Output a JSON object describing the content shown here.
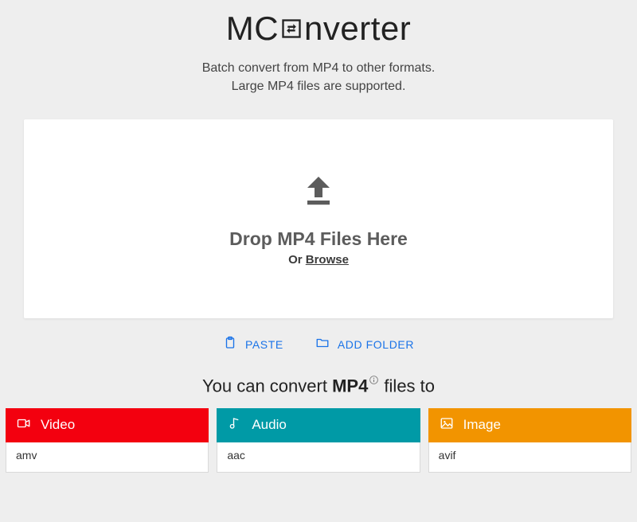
{
  "logo": {
    "prefix": "MC",
    "suffix": "nverter"
  },
  "subtitle": {
    "line1": "Batch convert from MP4 to other formats.",
    "line2": "Large MP4 files are supported."
  },
  "dropzone": {
    "title": "Drop MP4 Files Here",
    "or_prefix": "Or ",
    "browse": "Browse"
  },
  "actions": {
    "paste": "PASTE",
    "add_folder": "ADD FOLDER"
  },
  "convert_line": {
    "prefix": "You can convert ",
    "format": "MP4",
    "suffix": " files to"
  },
  "categories": {
    "video": {
      "label": "Video",
      "first_item": "amv"
    },
    "audio": {
      "label": "Audio",
      "first_item": "aac"
    },
    "image": {
      "label": "Image",
      "first_item": "avif"
    }
  }
}
